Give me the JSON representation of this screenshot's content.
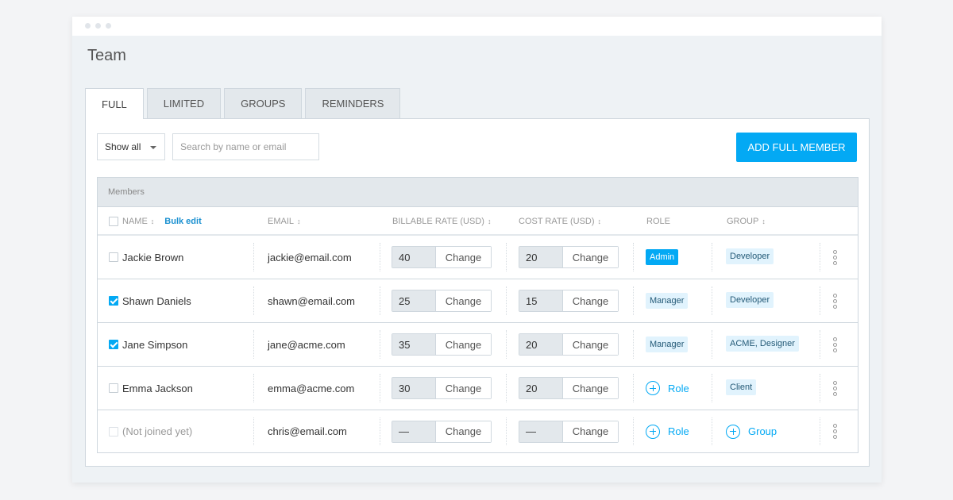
{
  "page": {
    "title": "Team"
  },
  "tabs": [
    {
      "label": "FULL",
      "active": true
    },
    {
      "label": "LIMITED",
      "active": false
    },
    {
      "label": "GROUPS",
      "active": false
    },
    {
      "label": "REMINDERS",
      "active": false
    }
  ],
  "toolbar": {
    "filter_value": "Show all",
    "search_placeholder": "Search by name or email",
    "search_value": "",
    "add_button_label": "ADD FULL MEMBER"
  },
  "table": {
    "section_label": "Members",
    "bulk_edit_label": "Bulk edit",
    "columns": {
      "name": "NAME",
      "email": "EMAIL",
      "billable_rate": "BILLABLE RATE (USD)",
      "cost_rate": "COST RATE (USD)",
      "role": "ROLE",
      "group": "GROUP"
    },
    "change_label": "Change",
    "add_role_label": "Role",
    "add_group_label": "Group",
    "rows": [
      {
        "name": "Jackie Brown",
        "checked": false,
        "joined": true,
        "email": "jackie@email.com",
        "billable_rate": "40",
        "cost_rate": "20",
        "role": "Admin",
        "group": "Developer"
      },
      {
        "name": "Shawn Daniels",
        "checked": true,
        "joined": true,
        "email": "shawn@email.com",
        "billable_rate": "25",
        "cost_rate": "15",
        "role": "Manager",
        "group": "Developer"
      },
      {
        "name": "Jane Simpson",
        "checked": true,
        "joined": true,
        "email": "jane@acme.com",
        "billable_rate": "35",
        "cost_rate": "20",
        "role": "Manager",
        "group": "ACME, Designer"
      },
      {
        "name": "Emma Jackson",
        "checked": false,
        "joined": true,
        "email": "emma@acme.com",
        "billable_rate": "30",
        "cost_rate": "20",
        "role": "",
        "group": "Client"
      },
      {
        "name": "(Not joined yet)",
        "checked": false,
        "joined": false,
        "email": "chris@email.com",
        "billable_rate": "—",
        "cost_rate": "—",
        "role": "",
        "group": ""
      }
    ]
  },
  "colors": {
    "accent": "#03a9f4",
    "badge_bg": "#e1f3fd",
    "header_bg": "#e3e8ec"
  }
}
